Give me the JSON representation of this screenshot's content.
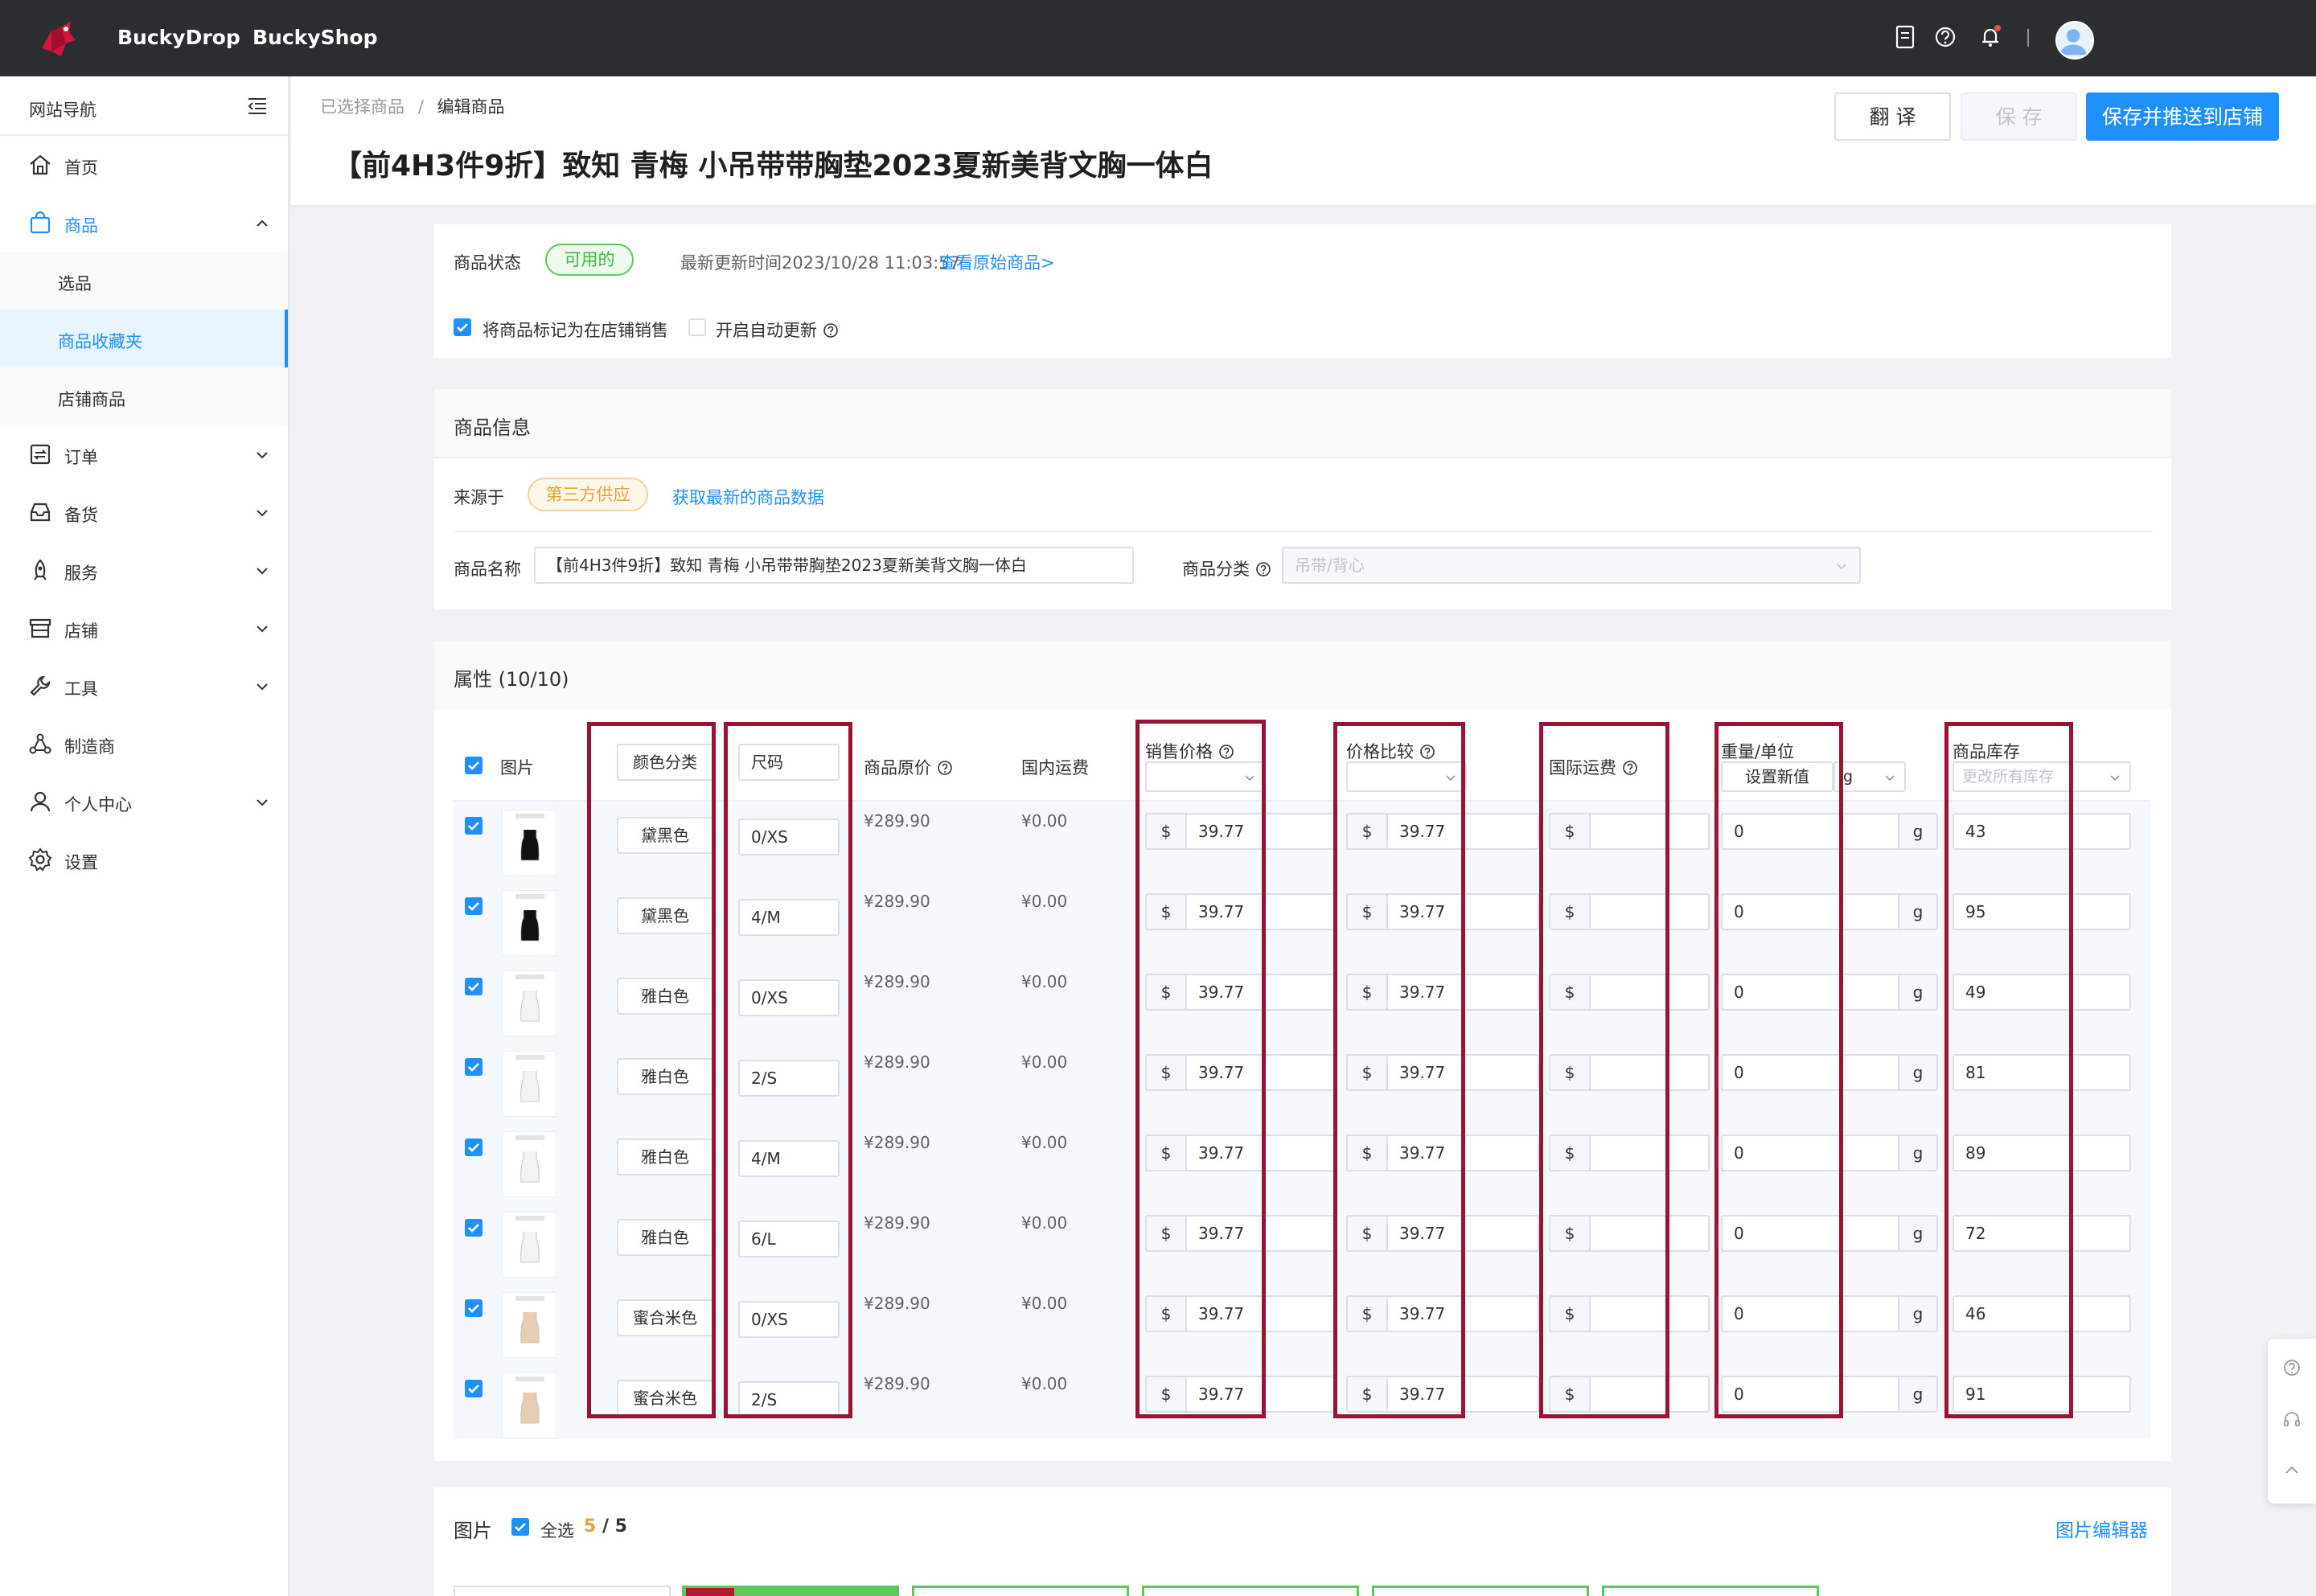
{
  "topbar": {
    "brand1": "BuckyDrop",
    "brand2": "BuckyShop"
  },
  "sidebar": {
    "header": "网站导航",
    "items": [
      {
        "label": "首页"
      },
      {
        "label": "商品",
        "children": [
          {
            "label": "选品"
          },
          {
            "label": "商品收藏夹"
          },
          {
            "label": "店铺商品"
          }
        ]
      },
      {
        "label": "订单"
      },
      {
        "label": "备货"
      },
      {
        "label": "服务"
      },
      {
        "label": "店铺"
      },
      {
        "label": "工具"
      },
      {
        "label": "制造商"
      },
      {
        "label": "个人中心"
      },
      {
        "label": "设置"
      }
    ]
  },
  "header": {
    "breadcrumb_parent": "已选择商品",
    "breadcrumb_sep": "/",
    "breadcrumb_current": "编辑商品",
    "title": "【前4H3件9折】致知 青梅 小吊带带胸垫2023夏新美背文胸一体白",
    "translate_label": "翻 译",
    "save_label": "保 存",
    "save_push_label": "保存并推送到店铺"
  },
  "status": {
    "label": "商品状态",
    "tag": "可用的",
    "updated": "最新更新时间2023/10/28 11:03:57",
    "view_original": "查看原始商品>",
    "mark_label": "将商品标记为在店铺销售",
    "auto_update_label": "开启自动更新"
  },
  "info": {
    "title": "商品信息",
    "source_label": "来源于",
    "source_tag": "第三方供应",
    "fetch_link": "获取最新的商品数据",
    "name_label": "商品名称",
    "name_value": "【前4H3件9折】致知 青梅 小吊带带胸垫2023夏新美背文胸一体白",
    "category_label": "商品分类",
    "category_value": "吊带/背心"
  },
  "attrs": {
    "title": "属性 (10/10)",
    "headers": {
      "image": "图片",
      "color": "颜色分类",
      "size": "尺码",
      "orig_price": "商品原价",
      "domestic_ship": "国内运费",
      "sale_price": "销售价格",
      "compare_price": "价格比较",
      "intl_ship": "国际运费",
      "weight": "重量/单位",
      "weight_set": "设置新值",
      "weight_unit": "g",
      "stock": "商品库存",
      "stock_placeholder": "更改所有库存"
    },
    "currency": "$",
    "weight_suffix": "g",
    "rows": [
      {
        "color": "黛黑色",
        "size": "0/XS",
        "orig": "¥289.90",
        "ship": "¥0.00",
        "sale": "39.77",
        "compare": "39.77",
        "intl": "",
        "weight": "0",
        "stock": "43",
        "swatch": "#111111"
      },
      {
        "color": "黛黑色",
        "size": "4/M",
        "orig": "¥289.90",
        "ship": "¥0.00",
        "sale": "39.77",
        "compare": "39.77",
        "intl": "",
        "weight": "0",
        "stock": "95",
        "swatch": "#111111"
      },
      {
        "color": "雅白色",
        "size": "0/XS",
        "orig": "¥289.90",
        "ship": "¥0.00",
        "sale": "39.77",
        "compare": "39.77",
        "intl": "",
        "weight": "0",
        "stock": "49",
        "swatch": "#f3f3f3"
      },
      {
        "color": "雅白色",
        "size": "2/S",
        "orig": "¥289.90",
        "ship": "¥0.00",
        "sale": "39.77",
        "compare": "39.77",
        "intl": "",
        "weight": "0",
        "stock": "81",
        "swatch": "#f3f3f3"
      },
      {
        "color": "雅白色",
        "size": "4/M",
        "orig": "¥289.90",
        "ship": "¥0.00",
        "sale": "39.77",
        "compare": "39.77",
        "intl": "",
        "weight": "0",
        "stock": "89",
        "swatch": "#f3f3f3"
      },
      {
        "color": "雅白色",
        "size": "6/L",
        "orig": "¥289.90",
        "ship": "¥0.00",
        "sale": "39.77",
        "compare": "39.77",
        "intl": "",
        "weight": "0",
        "stock": "72",
        "swatch": "#f3f3f3"
      },
      {
        "color": "蜜合米色",
        "size": "0/XS",
        "orig": "¥289.90",
        "ship": "¥0.00",
        "sale": "39.77",
        "compare": "39.77",
        "intl": "",
        "weight": "0",
        "stock": "46",
        "swatch": "#e8cdb3"
      },
      {
        "color": "蜜合米色",
        "size": "2/S",
        "orig": "¥289.90",
        "ship": "¥0.00",
        "sale": "39.77",
        "compare": "39.77",
        "intl": "",
        "weight": "0",
        "stock": "91",
        "swatch": "#e8cdb3"
      }
    ]
  },
  "images": {
    "title": "图片",
    "select_all": "全选",
    "count_selected": "5",
    "count_sep": " / ",
    "count_total": "5",
    "editor_link": "图片编辑器"
  },
  "colors": {
    "accent": "#1e90ff",
    "highlight": "#9b1235",
    "topbar": "#2b2d30"
  }
}
